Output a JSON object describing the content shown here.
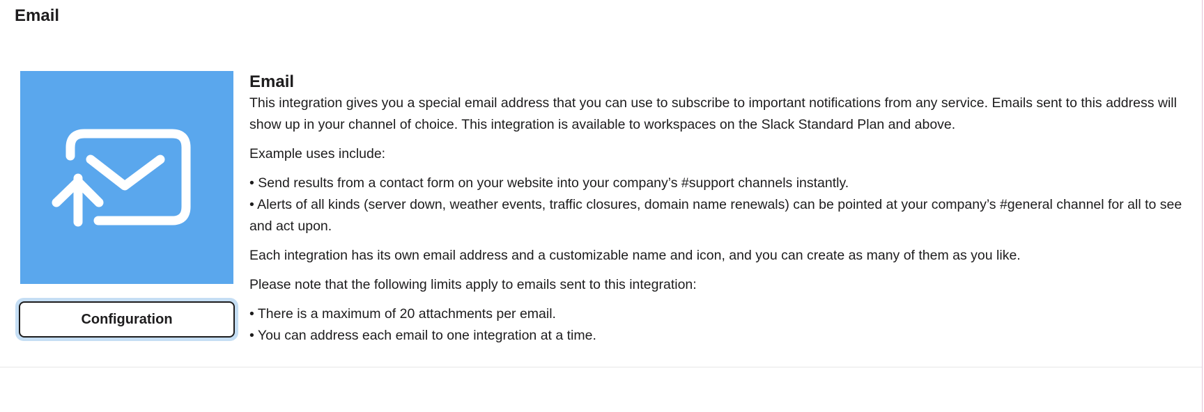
{
  "page": {
    "title": "Email"
  },
  "app": {
    "icon": "email-forward-icon",
    "icon_bg": "#5aa7ed",
    "name": "Email",
    "configuration_label": "Configuration"
  },
  "description": {
    "intro": "This integration gives you a special email address that you can use to subscribe to important notifications from any service. Emails sent to this address will show up in your channel of choice. This integration is available to workspaces on the Slack Standard Plan and above.",
    "examples_heading": "Example uses include:",
    "examples": [
      "• Send results from a contact form on your website into your company’s #support channels instantly.",
      "• Alerts of all kinds (server down, weather events, traffic closures, domain name renewals) can be pointed at your company’s #general channel for all to see and act upon."
    ],
    "naming_note": "Each integration has its own email address and a customizable name and icon, and you can create as many of them as you like.",
    "limits_heading": "Please note that the following limits apply to emails sent to this integration:",
    "limits": [
      "• There is a maximum of 20 attachments per email.",
      "• You can address each email to one integration at a time."
    ]
  }
}
